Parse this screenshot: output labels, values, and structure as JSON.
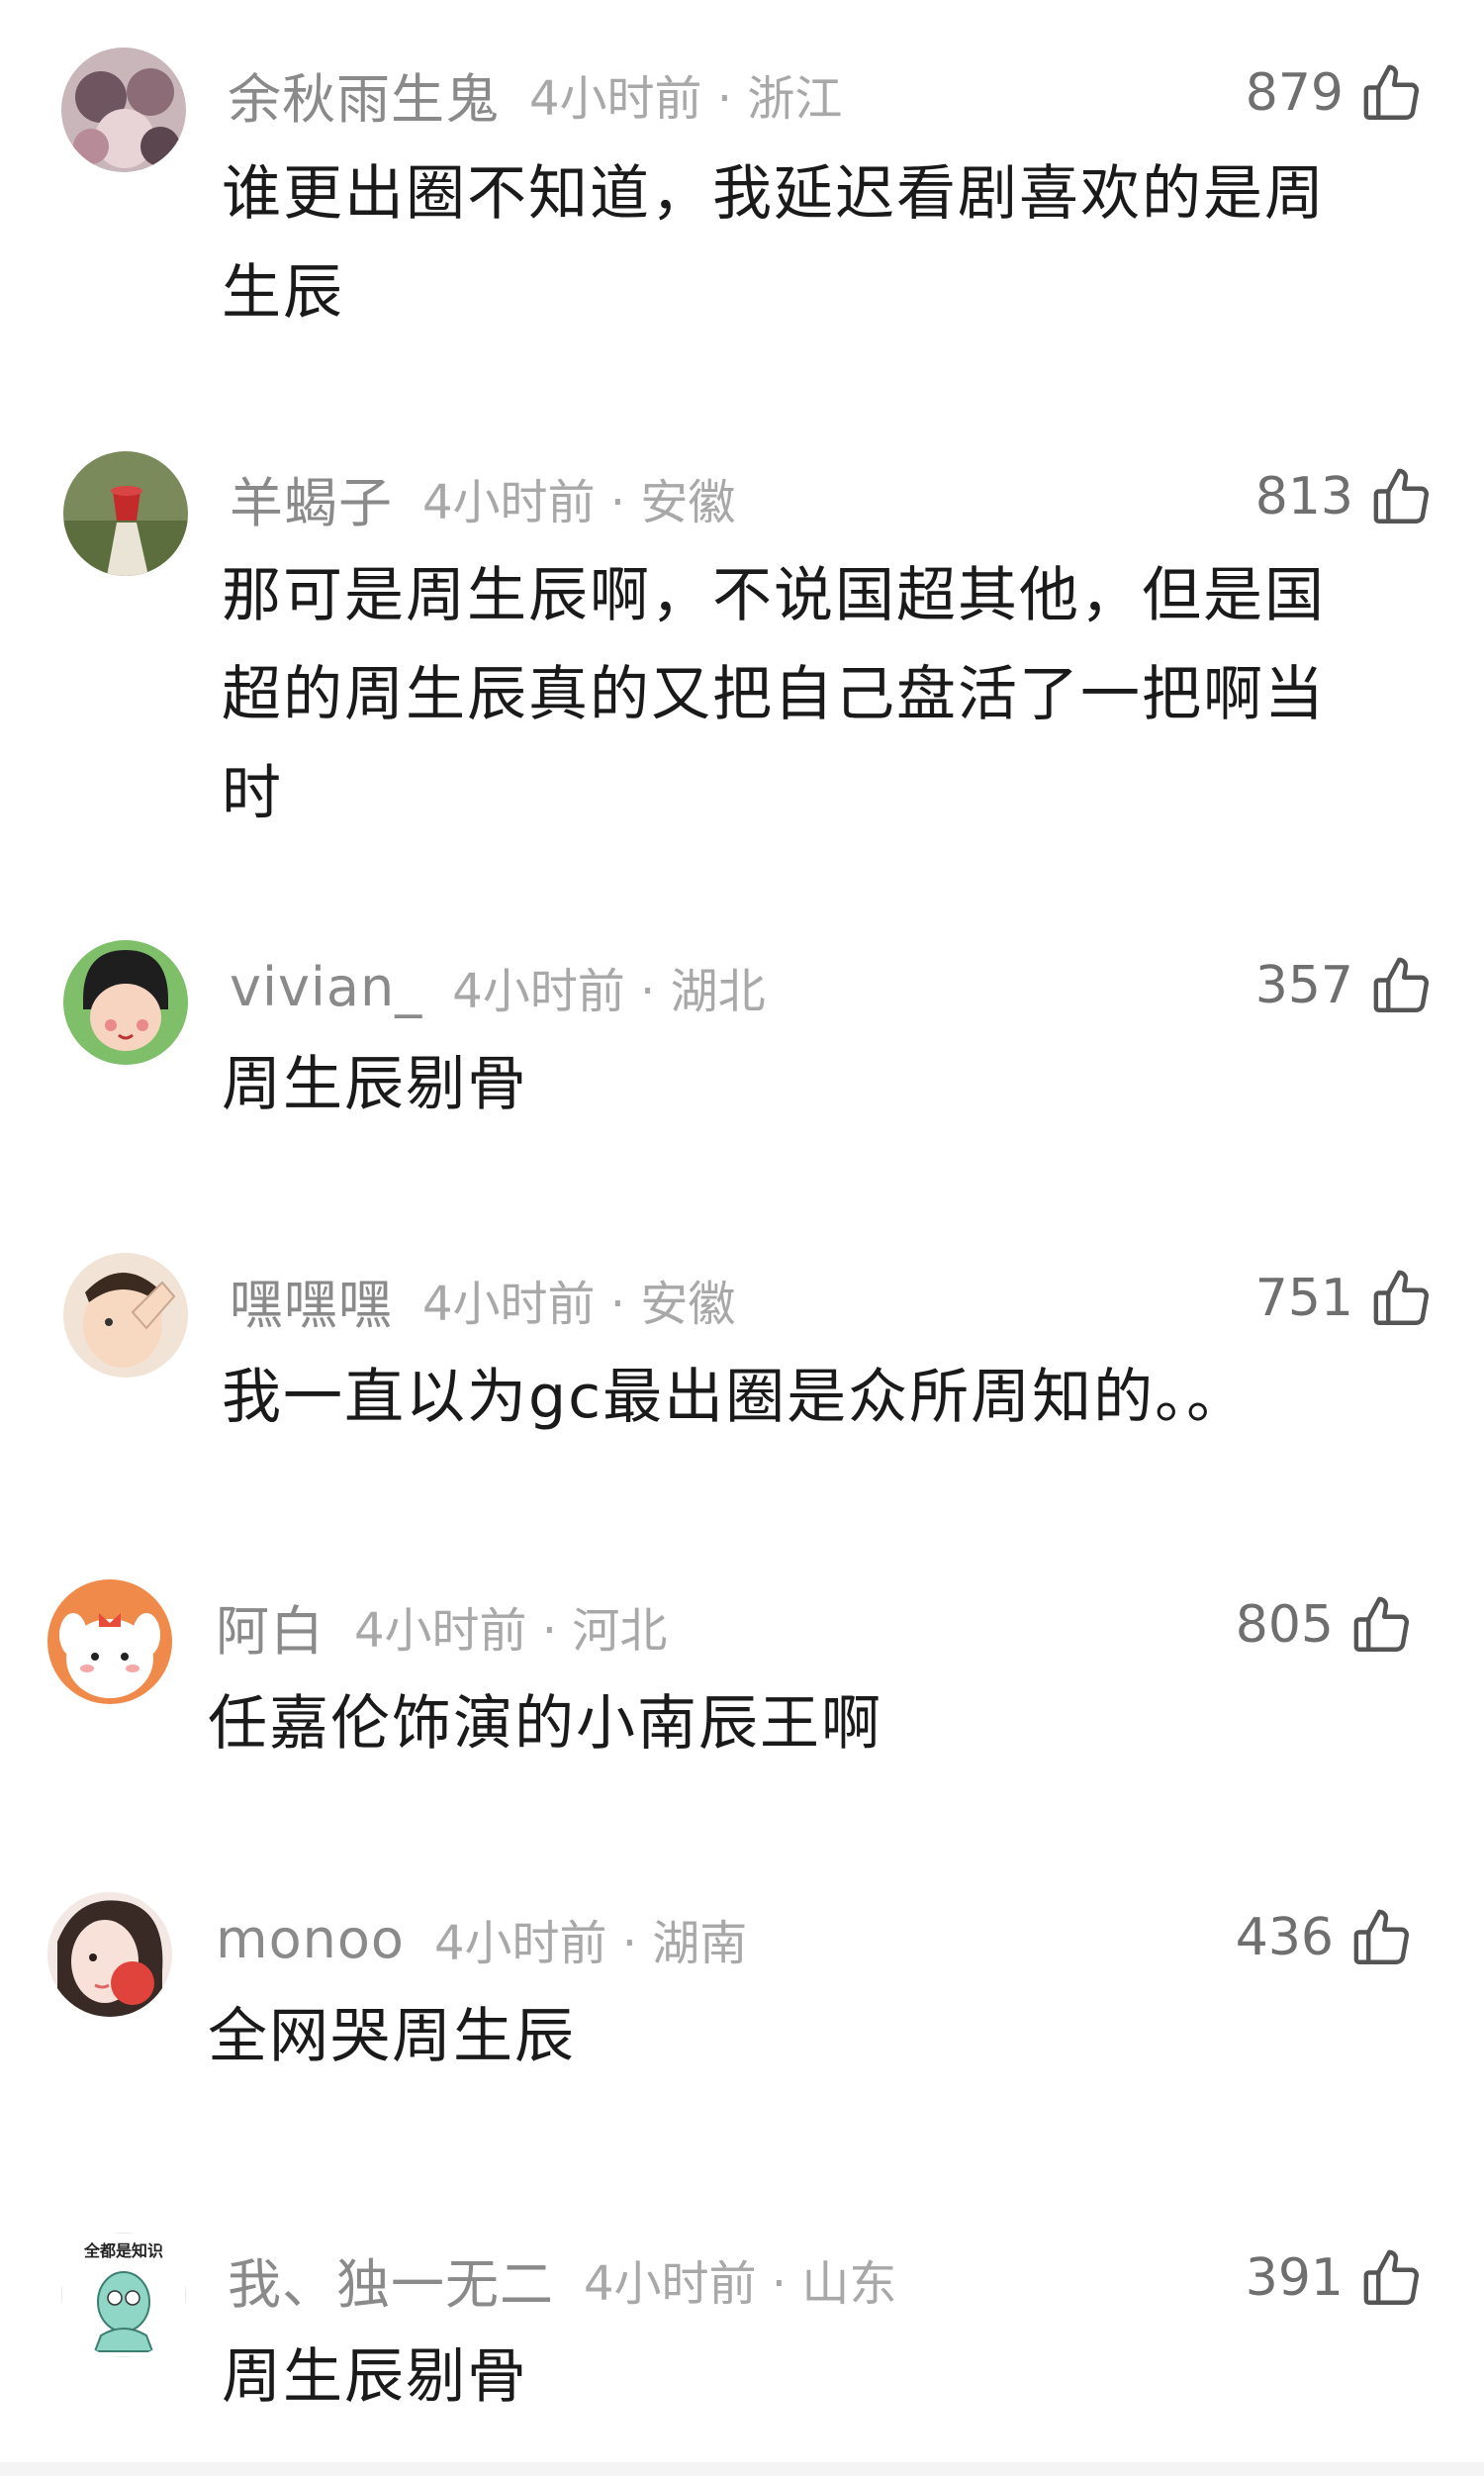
{
  "comments": [
    {
      "username": "余秋雨生鬼",
      "meta": "4小时前 · 浙江",
      "likes": "879",
      "lines": [
        "谁更出圈不知道，我延迟看剧喜欢的是周",
        "生辰"
      ]
    },
    {
      "username": "羊蝎子",
      "meta": "4小时前 · 安徽",
      "likes": "813",
      "lines": [
        "那可是周生辰啊，不说国超其他，但是国",
        "超的周生辰真的又把自己盘活了一把啊当",
        "时"
      ]
    },
    {
      "username": "vivian_",
      "meta": "4小时前 · 湖北",
      "likes": "357",
      "lines": [
        "周生辰剔骨"
      ]
    },
    {
      "username": "嘿嘿嘿",
      "meta": "4小时前 · 安徽",
      "likes": "751",
      "lines": [
        "我一直以为gc最出圈是众所周知的。。"
      ]
    },
    {
      "username": "阿白",
      "meta": "4小时前 · 河北",
      "likes": "805",
      "lines": [
        "任嘉伦饰演的小南辰王啊"
      ]
    },
    {
      "username": "monoo",
      "meta": "4小时前 · 湖南",
      "likes": "436",
      "lines": [
        "全网哭周生辰"
      ]
    },
    {
      "username": "我、独一无二",
      "meta": "4小时前 · 山东",
      "likes": "391",
      "lines": [
        "周生辰剔骨"
      ],
      "avatar_text": "全都是知识"
    }
  ],
  "colors": {
    "username": "#8a8a8a",
    "meta": "#a8a8a8",
    "body": "#1a1a1a",
    "likes": "#6f6f6f"
  }
}
